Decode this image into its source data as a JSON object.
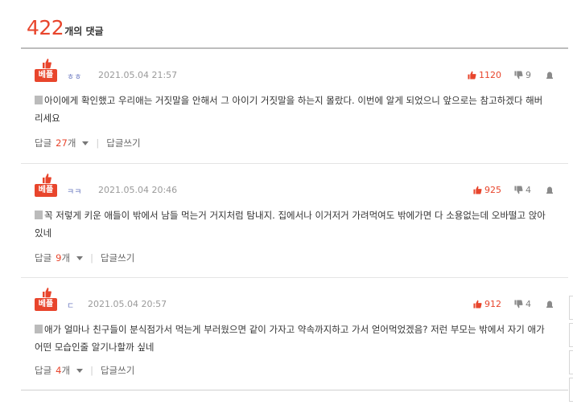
{
  "header": {
    "count": "422",
    "count_label": "개의 댓글"
  },
  "comments": [
    {
      "badge": "베플",
      "nick": "ㅎㅎ",
      "date": "2021.05.04 21:57",
      "up": "1120",
      "down": "9",
      "text": "아이에게 확인했고 우리애는 거짓말을 안해서 그 아이기 거짓말을 하는지 몰랐다. 이번에 알게 되었으니 앞으로는 참고하겠다 해버리세요",
      "reply_label": "답글",
      "reply_count": "27",
      "reply_unit": "개",
      "separator": "|",
      "write_label": "답글쓰기"
    },
    {
      "badge": "베플",
      "nick": "ㅋㅋ",
      "date": "2021.05.04 20:46",
      "up": "925",
      "down": "4",
      "text": "꼭 저렇게 키운 애들이 밖에서 남들 먹는거 거지처럼 탐내지. 집에서나 이거저거 가려먹여도 밖에가면 다 소용없는데 오바떨고 앉아있네",
      "reply_label": "답글",
      "reply_count": "9",
      "reply_unit": "개",
      "separator": "|",
      "write_label": "답글쓰기"
    },
    {
      "badge": "베플",
      "nick": "ㄷ",
      "date": "2021.05.04 20:57",
      "up": "912",
      "down": "4",
      "text": "애가 얼마나 친구들이 분식점가서 먹는게 부러웠으면 같이 가자고 약속까지하고 가서 얻어먹었겠음? 저런 부모는 밖에서 자기 애가 어떤 모습인줄 알기나할까 싶네",
      "reply_label": "답글",
      "reply_count": "4",
      "reply_unit": "개",
      "separator": "|",
      "write_label": "답글쓰기"
    }
  ],
  "colors": {
    "accent": "#e8452c",
    "nick": "#6f7dc2",
    "muted": "#9a9a9a"
  },
  "icons": {
    "best": "thumbs-up-icon",
    "up": "thumbs-up-icon",
    "down": "thumbs-down-icon",
    "report": "siren-icon",
    "doc": "document-icon",
    "dropdown": "triangle-down-icon"
  }
}
